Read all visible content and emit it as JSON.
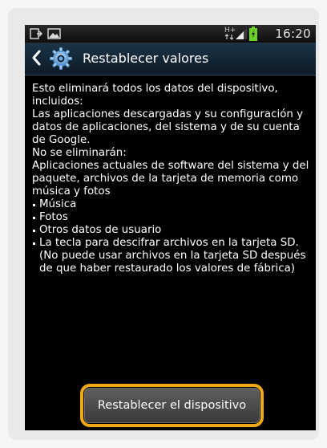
{
  "status_bar": {
    "time": "16:20",
    "network_label": "H+",
    "icons": [
      "notification-icon",
      "image-icon",
      "network-icon",
      "signal-icon",
      "battery-icon"
    ]
  },
  "title_bar": {
    "title": "Restablecer valores",
    "back_icon": "back-chevron-icon",
    "settings_icon": "gear-icon"
  },
  "content": {
    "intro": "Esto eliminará todos los datos del dispositivo, incluidos:",
    "included": "Las aplicaciones descargadas y su configuración y datos de aplicaciones, del sistema y de su cuenta de Google.",
    "not_deleted_heading": "No se eliminarán:",
    "not_deleted_text": "Aplicaciones actuales de software del sistema y del paquete, archivos de la tarjeta de memoria como música y fotos",
    "bullets": [
      "Música",
      "Fotos",
      "Otros datos de usuario",
      "La tecla para descifrar archivos en la tarjeta SD. (No puede usar archivos en la tarjeta SD después de que haber restaurado los valores de fábrica)"
    ]
  },
  "button": {
    "label": "Restablecer el dispositivo",
    "highlight_color": "#f0a818"
  }
}
